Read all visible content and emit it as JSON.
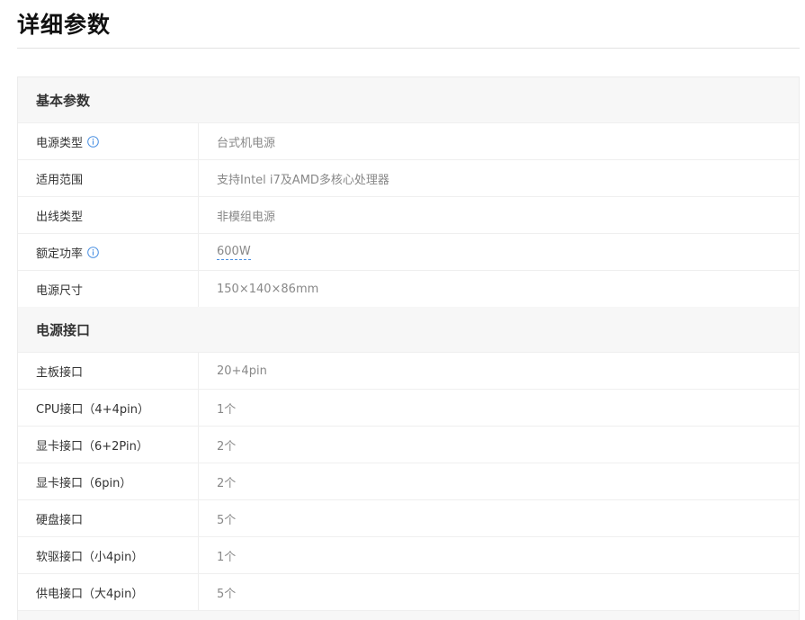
{
  "page": {
    "title": "详细参数"
  },
  "sections": [
    {
      "title": "基本参数",
      "rows": [
        {
          "label": "电源类型",
          "value": "台式机电源"
        },
        {
          "label": "适用范围",
          "value": "支持Intel i7及AMD多核心处理器"
        },
        {
          "label": "出线类型",
          "value": "非模组电源"
        },
        {
          "label": "额定功率",
          "value": "600W"
        },
        {
          "label": "电源尺寸",
          "value": "150×140×86mm"
        }
      ]
    },
    {
      "title": "电源接口",
      "rows": [
        {
          "label": "主板接口",
          "value": "20+4pin"
        },
        {
          "label": "CPU接口（4+4pin）",
          "value": "1个"
        },
        {
          "label": "显卡接口（6+2Pin）",
          "value": "2个"
        },
        {
          "label": "显卡接口（6pin）",
          "value": "2个"
        },
        {
          "label": "硬盘接口",
          "value": "5个"
        },
        {
          "label": "软驱接口（小4pin）",
          "value": "1个"
        },
        {
          "label": "供电接口（大4pin）",
          "value": "5个"
        }
      ]
    }
  ],
  "icons": {
    "info": "info-circle-icon"
  },
  "colors": {
    "info_icon": "#4a90e2",
    "header_bg": "#f7f7f7"
  }
}
